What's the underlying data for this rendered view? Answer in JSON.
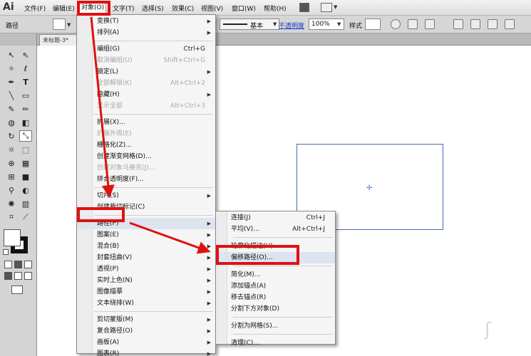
{
  "app": {
    "logo": "Ai"
  },
  "menubar": {
    "items": [
      {
        "label": "文件(F)",
        "active": false
      },
      {
        "label": "编辑(E)",
        "active": false
      },
      {
        "label": "对象(O)",
        "active": true
      },
      {
        "label": "文字(T)",
        "active": false
      },
      {
        "label": "选择(S)",
        "active": false
      },
      {
        "label": "效果(C)",
        "active": false
      },
      {
        "label": "视图(V)",
        "active": false
      },
      {
        "label": "窗口(W)",
        "active": false
      },
      {
        "label": "帮助(H)",
        "active": false
      }
    ]
  },
  "controlbar": {
    "selection_label": "路径",
    "stroke_style": "基本",
    "opacity_label": "不透明度",
    "opacity_value": "100%",
    "style_label": "样式"
  },
  "document": {
    "tab_title": "未标题-3*",
    "tab_close": "✕"
  },
  "object_menu": {
    "items": [
      {
        "label": "变换(T)",
        "shortcut": "",
        "submenu": true,
        "disabled": false
      },
      {
        "label": "排列(A)",
        "shortcut": "",
        "submenu": true,
        "disabled": false
      },
      {
        "sep": true
      },
      {
        "label": "编组(G)",
        "shortcut": "Ctrl+G",
        "submenu": false,
        "disabled": false
      },
      {
        "label": "取消编组(U)",
        "shortcut": "Shift+Ctrl+G",
        "submenu": false,
        "disabled": true
      },
      {
        "label": "锁定(L)",
        "shortcut": "",
        "submenu": true,
        "disabled": false
      },
      {
        "label": "全部解锁(K)",
        "shortcut": "Alt+Ctrl+2",
        "submenu": false,
        "disabled": true
      },
      {
        "label": "隐藏(H)",
        "shortcut": "",
        "submenu": true,
        "disabled": false
      },
      {
        "label": "显示全部",
        "shortcut": "Alt+Ctrl+3",
        "submenu": false,
        "disabled": true
      },
      {
        "sep": true
      },
      {
        "label": "扩展(X)...",
        "shortcut": "",
        "submenu": false,
        "disabled": false
      },
      {
        "label": "扩展外观(E)",
        "shortcut": "",
        "submenu": false,
        "disabled": true
      },
      {
        "label": "栅格化(Z)...",
        "shortcut": "",
        "submenu": false,
        "disabled": false
      },
      {
        "label": "创建渐变网格(D)...",
        "shortcut": "",
        "submenu": false,
        "disabled": false
      },
      {
        "label": "创建对象马赛克(J)...",
        "shortcut": "",
        "submenu": false,
        "disabled": true
      },
      {
        "label": "拼合透明度(F)...",
        "shortcut": "",
        "submenu": false,
        "disabled": false
      },
      {
        "sep": true
      },
      {
        "label": "切片(S)",
        "shortcut": "",
        "submenu": true,
        "disabled": false
      },
      {
        "label": "创建裁切标记(C)",
        "shortcut": "",
        "submenu": false,
        "disabled": false
      },
      {
        "sep": true
      },
      {
        "label": "路径(P)",
        "shortcut": "",
        "submenu": true,
        "disabled": false,
        "highlight": true
      },
      {
        "label": "图案(E)",
        "shortcut": "",
        "submenu": true,
        "disabled": false
      },
      {
        "label": "混合(B)",
        "shortcut": "",
        "submenu": true,
        "disabled": false
      },
      {
        "label": "封套扭曲(V)",
        "shortcut": "",
        "submenu": true,
        "disabled": false
      },
      {
        "label": "透视(P)",
        "shortcut": "",
        "submenu": true,
        "disabled": false
      },
      {
        "label": "实时上色(N)",
        "shortcut": "",
        "submenu": true,
        "disabled": false
      },
      {
        "label": "图像描摹",
        "shortcut": "",
        "submenu": true,
        "disabled": false
      },
      {
        "label": "文本绕排(W)",
        "shortcut": "",
        "submenu": true,
        "disabled": false
      },
      {
        "sep": true
      },
      {
        "label": "剪切蒙版(M)",
        "shortcut": "",
        "submenu": true,
        "disabled": false
      },
      {
        "label": "复合路径(O)",
        "shortcut": "",
        "submenu": true,
        "disabled": false
      },
      {
        "label": "画板(A)",
        "shortcut": "",
        "submenu": true,
        "disabled": false
      },
      {
        "label": "图表(R)",
        "shortcut": "",
        "submenu": true,
        "disabled": false
      }
    ]
  },
  "path_submenu": {
    "items": [
      {
        "label": "连接(J)",
        "shortcut": "Ctrl+J",
        "disabled": false
      },
      {
        "label": "平均(V)...",
        "shortcut": "Alt+Ctrl+J",
        "disabled": false
      },
      {
        "sep": true
      },
      {
        "label": "轮廓化描边(U)",
        "shortcut": "",
        "disabled": false
      },
      {
        "label": "偏移路径(O)...",
        "shortcut": "",
        "disabled": false,
        "highlight": true
      },
      {
        "sep": true
      },
      {
        "label": "简化(M)...",
        "shortcut": "",
        "disabled": false
      },
      {
        "label": "添加锚点(A)",
        "shortcut": "",
        "disabled": false
      },
      {
        "label": "移去锚点(R)",
        "shortcut": "",
        "disabled": false
      },
      {
        "label": "分割下方对象(D)",
        "shortcut": "",
        "disabled": false
      },
      {
        "sep": true
      },
      {
        "label": "分割为网格(S)...",
        "shortcut": "",
        "disabled": false
      },
      {
        "sep": true
      },
      {
        "label": "清理(C)...",
        "shortcut": "",
        "disabled": false
      }
    ]
  },
  "colors": {
    "annotation": "#e01010",
    "shape_stroke": "#4967b4"
  }
}
